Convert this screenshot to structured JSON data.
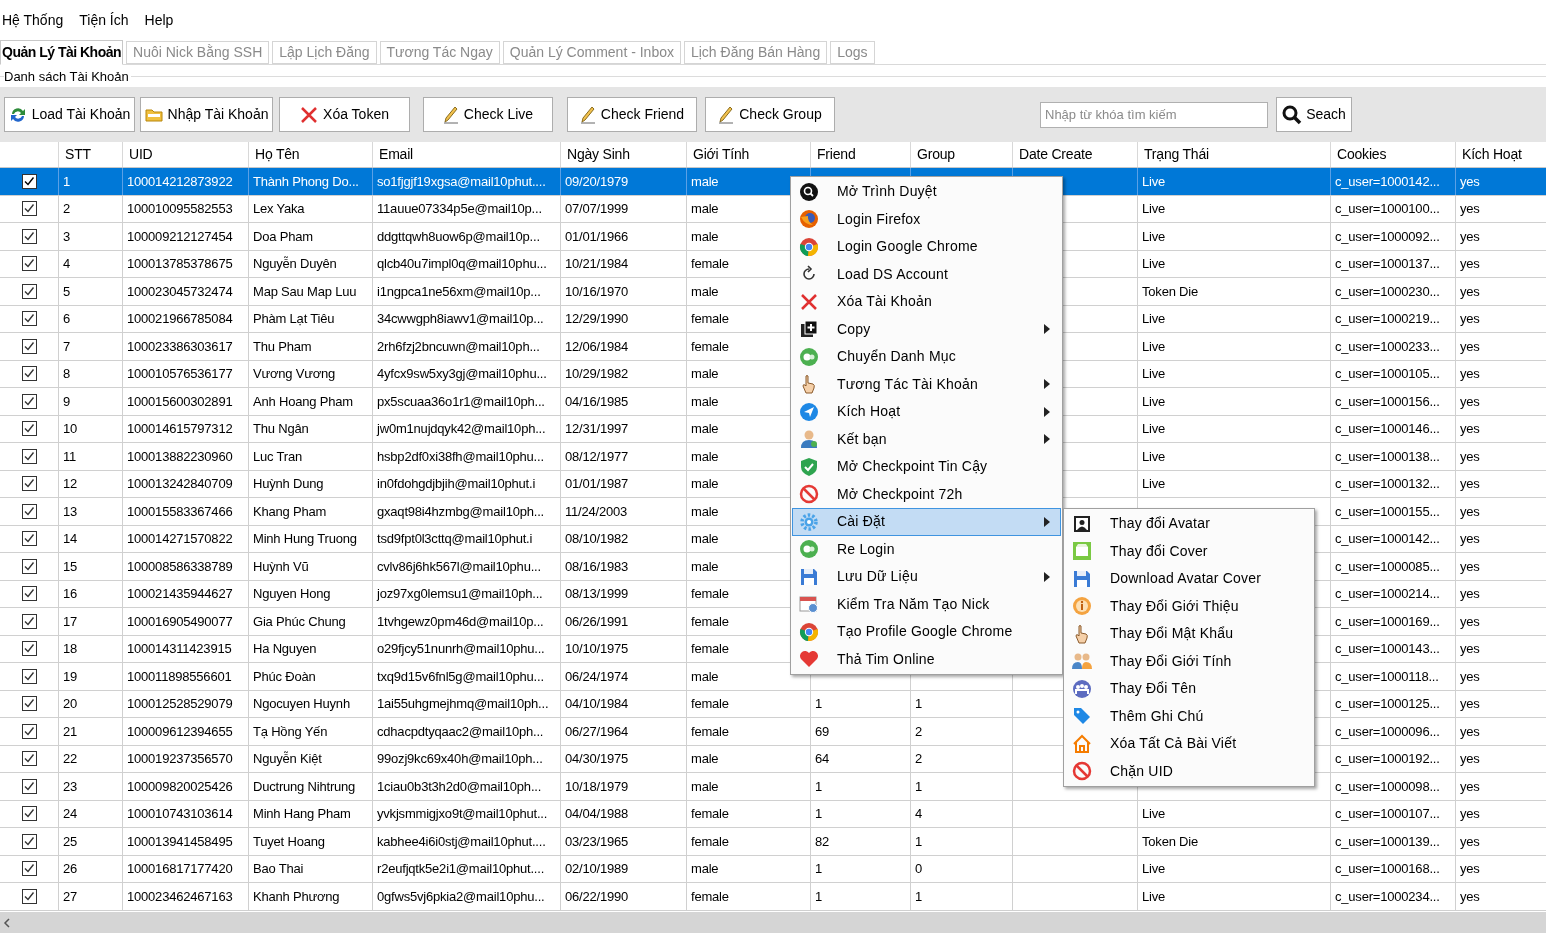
{
  "menu_bar": [
    "Hệ Thống",
    "Tiện Ích",
    "Help"
  ],
  "tabs": [
    {
      "label": "Quản Lý Tài Khoản",
      "selected": true
    },
    {
      "label": "Nuôi Nick Bằng SSH",
      "selected": false
    },
    {
      "label": "Lập Lịch Đăng",
      "selected": false
    },
    {
      "label": "Tương Tác Ngay",
      "selected": false
    },
    {
      "label": "Quản Lý Comment - Inbox",
      "selected": false
    },
    {
      "label": "Lịch Đăng Bán Hàng",
      "selected": false
    },
    {
      "label": "Logs",
      "selected": false
    }
  ],
  "group_title": "Danh sách Tài Khoản",
  "toolbar": [
    {
      "label": "Load Tài Khoản",
      "kind": "refresh"
    },
    {
      "label": "Nhập Tài Khoản",
      "kind": "folder"
    },
    {
      "label": "Xóa Token",
      "kind": "delete"
    },
    {
      "label": "Check Live",
      "kind": "pencil"
    },
    {
      "label": "Check Friend",
      "kind": "pencil"
    },
    {
      "label": "Check Group",
      "kind": "pencil"
    }
  ],
  "search": {
    "placeholder": "Nhập từ khóa tìm kiếm",
    "button": "Seach"
  },
  "table": {
    "columns": [
      "STT",
      "UID",
      "Họ Tên",
      "Email",
      "Ngày Sinh",
      "Giới Tính",
      "Friend",
      "Group",
      "Date Create",
      "Trạng Thái",
      "Cookies",
      "Kích Hoạt"
    ],
    "rows": [
      {
        "checked": true,
        "selected": true,
        "stt": "1",
        "uid": "100014212873922",
        "name": "Thành Phong Do...",
        "email": "so1fjgjf19xgsa@mail10phut....",
        "birthday": "09/20/1979",
        "gender": "male",
        "status": "Live",
        "cookies": "c_user=1000142...",
        "active": "yes"
      },
      {
        "checked": true,
        "selected": false,
        "stt": "2",
        "uid": "100010095582553",
        "name": "Lex Yaka",
        "email": "11auue07334p5e@mail10p...",
        "birthday": "07/07/1999",
        "gender": "male",
        "status": "Live",
        "cookies": "c_user=1000100...",
        "active": "yes"
      },
      {
        "checked": true,
        "selected": false,
        "stt": "3",
        "uid": "100009212127454",
        "name": "Doa Pham",
        "email": "ddgttqwh8uow6p@mail10p...",
        "birthday": "01/01/1966",
        "gender": "male",
        "status": "Live",
        "cookies": "c_user=1000092...",
        "active": "yes"
      },
      {
        "checked": true,
        "selected": false,
        "stt": "4",
        "uid": "100013785378675",
        "name": "Nguyễn Duyên",
        "email": "qlcb40u7impl0q@mail10phu...",
        "birthday": "10/21/1984",
        "gender": "female",
        "status": "Live",
        "cookies": "c_user=1000137...",
        "active": "yes"
      },
      {
        "checked": true,
        "selected": false,
        "stt": "5",
        "uid": "100023045732474",
        "name": "Map Sau Map Luu",
        "email": "i1ngpca1ne56xm@mail10p...",
        "birthday": "10/16/1970",
        "gender": "male",
        "status": "Token Die",
        "cookies": "c_user=1000230...",
        "active": "yes"
      },
      {
        "checked": true,
        "selected": false,
        "stt": "6",
        "uid": "100021966785084",
        "name": "Phàm Lạt Tiêu",
        "email": "34cwwgph8iawv1@mail10p...",
        "birthday": "12/29/1990",
        "gender": "female",
        "status": "Live",
        "cookies": "c_user=1000219...",
        "active": "yes"
      },
      {
        "checked": true,
        "selected": false,
        "stt": "7",
        "uid": "100023386303617",
        "name": "Thu Pham",
        "email": "2rh6fzj2bncuwn@mail10ph...",
        "birthday": "12/06/1984",
        "gender": "female",
        "status": "Live",
        "cookies": "c_user=1000233...",
        "active": "yes"
      },
      {
        "checked": true,
        "selected": false,
        "stt": "8",
        "uid": "100010576536177",
        "name": "Vương Vương",
        "email": "4yfcx9sw5xy3gj@mail10phu...",
        "birthday": "10/29/1982",
        "gender": "male",
        "status": "Live",
        "cookies": "c_user=1000105...",
        "active": "yes"
      },
      {
        "checked": true,
        "selected": false,
        "stt": "9",
        "uid": "100015600302891",
        "name": "Anh Hoang Pham",
        "email": "px5scuaa36o1r1@mail10ph...",
        "birthday": "04/16/1985",
        "gender": "male",
        "status": "Live",
        "cookies": "c_user=1000156...",
        "active": "yes"
      },
      {
        "checked": true,
        "selected": false,
        "stt": "10",
        "uid": "100014615797312",
        "name": "Thu Ngân",
        "email": "jw0m1nujdqyk42@mail10ph...",
        "birthday": "12/31/1997",
        "gender": "male",
        "status": "Live",
        "cookies": "c_user=1000146...",
        "active": "yes"
      },
      {
        "checked": true,
        "selected": false,
        "stt": "11",
        "uid": "100013882230960",
        "name": "Luc Tran",
        "email": "hsbp2df0xi38fh@mail10phu...",
        "birthday": "08/12/1977",
        "gender": "male",
        "status": "Live",
        "cookies": "c_user=1000138...",
        "active": "yes"
      },
      {
        "checked": true,
        "selected": false,
        "stt": "12",
        "uid": "100013242840709",
        "name": "Huỳnh Dung",
        "email": "in0fdohgdjbjih@mail10phut.i",
        "birthday": "01/01/1987",
        "gender": "male",
        "status": "Live",
        "cookies": "c_user=1000132...",
        "active": "yes"
      },
      {
        "checked": true,
        "selected": false,
        "stt": "13",
        "uid": "100015583367466",
        "name": "Khang Pham",
        "email": "gxaqt98i4hzmbg@mail10ph...",
        "birthday": "11/24/2003",
        "gender": "male",
        "cookies": "c_user=1000155...",
        "active": "yes"
      },
      {
        "checked": true,
        "selected": false,
        "stt": "14",
        "uid": "100014271570822",
        "name": "Minh Hung Truong",
        "email": "tsd9fpt0l3cttq@mail10phut.i",
        "birthday": "08/10/1982",
        "gender": "male",
        "cookies": "c_user=1000142...",
        "active": "yes"
      },
      {
        "checked": true,
        "selected": false,
        "stt": "15",
        "uid": "100008586338789",
        "name": "Huỳnh Vũ",
        "email": "cvlv86j6hk567l@mail10phu...",
        "birthday": "08/16/1983",
        "gender": "male",
        "cookies": "c_user=1000085...",
        "active": "yes"
      },
      {
        "checked": true,
        "selected": false,
        "stt": "16",
        "uid": "100021435944627",
        "name": "Nguyen Hong",
        "email": "joz97xg0lemsu1@mail10ph...",
        "birthday": "08/13/1999",
        "gender": "female",
        "cookies": "c_user=1000214...",
        "active": "yes"
      },
      {
        "checked": true,
        "selected": false,
        "stt": "17",
        "uid": "100016905490077",
        "name": "Gia Phúc Chung",
        "email": "1tvhgewz0pm46d@mail10p...",
        "birthday": "06/26/1991",
        "gender": "female",
        "cookies": "c_user=1000169...",
        "active": "yes"
      },
      {
        "checked": true,
        "selected": false,
        "stt": "18",
        "uid": "100014311423915",
        "name": "Ha Nguyen",
        "email": "o29fjcy51nunrh@mail10phu...",
        "birthday": "10/10/1975",
        "gender": "female",
        "cookies": "c_user=1000143...",
        "active": "yes"
      },
      {
        "checked": true,
        "selected": false,
        "stt": "19",
        "uid": "100011898556601",
        "name": "Phúc Đoàn",
        "email": "txq9d15v6fnl5g@mail10phu...",
        "birthday": "06/24/1974",
        "gender": "male",
        "cookies": "c_user=1000118...",
        "active": "yes"
      },
      {
        "checked": true,
        "selected": false,
        "stt": "20",
        "uid": "100012528529079",
        "name": "Ngocuyen Huynh",
        "email": "1ai55uhgmejhmq@mail10ph...",
        "birthday": "04/10/1984",
        "gender": "female",
        "friend": "1",
        "group": "1",
        "cookies": "c_user=1000125...",
        "active": "yes"
      },
      {
        "checked": true,
        "selected": false,
        "stt": "21",
        "uid": "100009612394655",
        "name": "Tạ Hồng Yến",
        "email": "cdhacpdtyqaac2@mail10ph...",
        "birthday": "06/27/1964",
        "gender": "female",
        "friend": "69",
        "group": "2",
        "cookies": "c_user=1000096...",
        "active": "yes"
      },
      {
        "checked": true,
        "selected": false,
        "stt": "22",
        "uid": "100019237356570",
        "name": "Nguyễn Kiệt",
        "email": "99ozj9kc69x40h@mail10ph...",
        "birthday": "04/30/1975",
        "gender": "male",
        "friend": "64",
        "group": "2",
        "cookies": "c_user=1000192...",
        "active": "yes"
      },
      {
        "checked": true,
        "selected": false,
        "stt": "23",
        "uid": "100009820025426",
        "name": "Ductrung Nihtrung",
        "email": "1ciau0b3t3h2d0@mail10ph...",
        "birthday": "10/18/1979",
        "gender": "male",
        "friend": "1",
        "group": "1",
        "cookies": "c_user=1000098...",
        "active": "yes"
      },
      {
        "checked": true,
        "selected": false,
        "stt": "24",
        "uid": "100010743103614",
        "name": "Minh Hang Pham",
        "email": "yvkjsmmigjxo9t@mail10phut...",
        "birthday": "04/04/1988",
        "gender": "female",
        "friend": "1",
        "group": "4",
        "status": "Live",
        "cookies": "c_user=1000107...",
        "active": "yes"
      },
      {
        "checked": true,
        "selected": false,
        "stt": "25",
        "uid": "100013941458495",
        "name": "Tuyet Hoang",
        "email": "kabhee4i6i0stj@mail10phut....",
        "birthday": "03/23/1965",
        "gender": "female",
        "friend": "82",
        "group": "1",
        "status": "Token Die",
        "cookies": "c_user=1000139...",
        "active": "yes"
      },
      {
        "checked": true,
        "selected": false,
        "stt": "26",
        "uid": "100016817177420",
        "name": "Bao Thai",
        "email": "r2eufjqtk5e2i1@mail10phut....",
        "birthday": "02/10/1989",
        "gender": "male",
        "friend": "1",
        "group": "0",
        "status": "Live",
        "cookies": "c_user=1000168...",
        "active": "yes"
      },
      {
        "checked": true,
        "selected": false,
        "stt": "27",
        "uid": "100023462467163",
        "name": "Khanh Phương",
        "email": "0gfws5vj6pkia2@mail10phu...",
        "birthday": "06/22/1990",
        "gender": "female",
        "friend": "1",
        "group": "1",
        "status": "Live",
        "cookies": "c_user=1000234...",
        "active": "yes"
      }
    ]
  },
  "context_menu": [
    {
      "label": "Mở Trình Duyệt",
      "kind": "browser",
      "submenu": false,
      "highlighted": false
    },
    {
      "label": "Login Firefox",
      "kind": "firefox",
      "submenu": false,
      "highlighted": false
    },
    {
      "label": "Login Google Chrome",
      "kind": "chrome",
      "submenu": false,
      "highlighted": false
    },
    {
      "label": "Load DS Account",
      "kind": "reload",
      "submenu": false,
      "highlighted": false
    },
    {
      "label": "Xóa Tài Khoản",
      "kind": "delete",
      "submenu": false,
      "highlighted": false
    },
    {
      "label": "Copy",
      "kind": "copy",
      "submenu": true,
      "highlighted": false
    },
    {
      "label": "Chuyển Danh Mục",
      "kind": "green",
      "submenu": false,
      "highlighted": false
    },
    {
      "label": "Tương Tác Tài Khoản",
      "kind": "hand",
      "submenu": true,
      "highlighted": false
    },
    {
      "label": "Kích Hoạt",
      "kind": "send",
      "submenu": true,
      "highlighted": false
    },
    {
      "label": "Kết bạn",
      "kind": "person",
      "submenu": true,
      "highlighted": false
    },
    {
      "label": "Mở Checkpoint Tin Cậy",
      "kind": "shield",
      "submenu": false,
      "highlighted": false
    },
    {
      "label": "Mở Checkpoint 72h",
      "kind": "ban",
      "submenu": false,
      "highlighted": false
    },
    {
      "label": "Cài Đặt",
      "kind": "gear",
      "submenu": true,
      "highlighted": true
    },
    {
      "label": "Re Login",
      "kind": "green",
      "submenu": false,
      "highlighted": false
    },
    {
      "label": "Lưu Dữ Liệu",
      "kind": "floppy",
      "submenu": true,
      "highlighted": false
    },
    {
      "label": "Kiểm Tra Năm Tạo Nick",
      "kind": "calendar",
      "submenu": false,
      "highlighted": false
    },
    {
      "label": "Tạo Profile Google Chrome",
      "kind": "chrome",
      "submenu": false,
      "highlighted": false
    },
    {
      "label": "Thả Tim Online",
      "kind": "heart",
      "submenu": false,
      "highlighted": false
    }
  ],
  "submenu": [
    {
      "label": "Thay đổi Avatar",
      "kind": "portrait"
    },
    {
      "label": "Thay đổi Cover",
      "kind": "picture"
    },
    {
      "label": "Download Avatar  Cover",
      "kind": "floppy"
    },
    {
      "label": "Thay Đổi Giới Thiệu",
      "kind": "info"
    },
    {
      "label": "Thay Đổi Mật Khẩu",
      "kind": "hand"
    },
    {
      "label": "Thay Đổi Giới Tính",
      "kind": "people"
    },
    {
      "label": "Thay Đổi Tên",
      "kind": "group"
    },
    {
      "label": "Thêm Ghi Chú",
      "kind": "tag"
    },
    {
      "label": "Xóa Tất Cả Bài Viết",
      "kind": "house"
    },
    {
      "label": "Chặn UID",
      "kind": "ban"
    }
  ]
}
